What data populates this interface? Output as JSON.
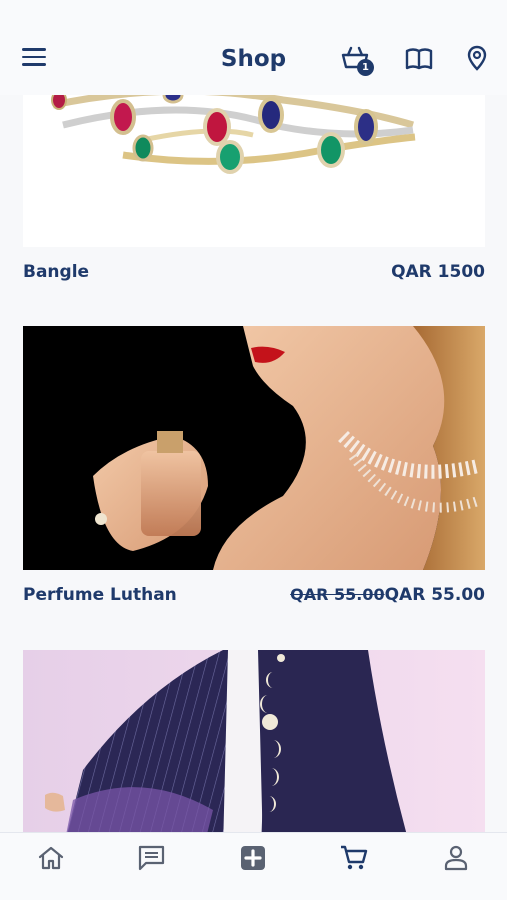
{
  "header": {
    "title": "Shop",
    "cart_count": "1",
    "icons": [
      "menu-icon",
      "basket-icon",
      "book-icon",
      "location-pin-icon"
    ]
  },
  "products": [
    {
      "name": "Bangle",
      "price": "QAR 1500",
      "old_price": "",
      "image": "bangle-bracelets"
    },
    {
      "name": "Perfume Luthan",
      "price": "QAR 55.00",
      "old_price": "QAR 55.00",
      "image": "woman-with-perfume"
    },
    {
      "name": "",
      "price": "",
      "old_price": "",
      "image": "abaya-garment"
    }
  ],
  "bottom_nav": {
    "items": [
      "home-icon",
      "chat-icon",
      "add-icon",
      "cart-icon",
      "profile-icon"
    ]
  },
  "colors": {
    "primary": "#1f3a6b",
    "background": "#f7f8fa"
  }
}
